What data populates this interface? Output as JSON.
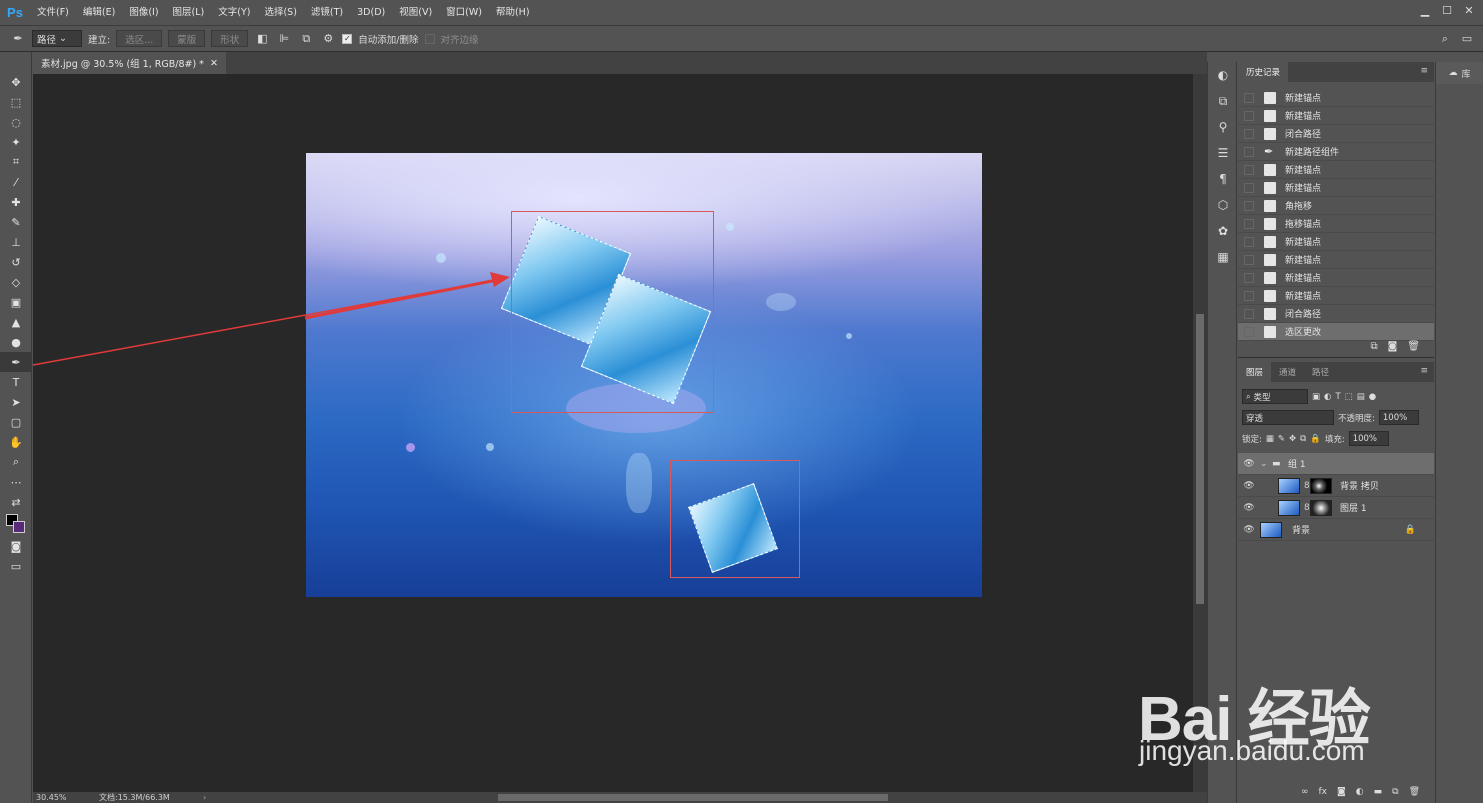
{
  "app": {
    "logo": "Ps"
  },
  "menu": [
    "文件(F)",
    "编辑(E)",
    "图像(I)",
    "图层(L)",
    "文字(Y)",
    "选择(S)",
    "滤镜(T)",
    "3D(D)",
    "视图(V)",
    "窗口(W)",
    "帮助(H)"
  ],
  "options": {
    "mode": "路径",
    "build_label": "建立:",
    "selection_btn": "选区...",
    "mask_btn": "蒙版",
    "shape_btn": "形状",
    "auto_add_delete": "自动添加/删除",
    "align_edges": "对齐边缘"
  },
  "document": {
    "tab_title": "素材.jpg @ 30.5% (组 1, RGB/8#) *",
    "zoom": "30.45%",
    "doc_size": "文档:15.3M/66.3M"
  },
  "history": {
    "title": "历史记录",
    "items": [
      "新建锚点",
      "新建锚点",
      "闭合路径",
      "新建路径组件",
      "新建锚点",
      "新建锚点",
      "角拖移",
      "拖移锚点",
      "新建锚点",
      "新建锚点",
      "新建锚点",
      "新建锚点",
      "闭合路径",
      "选区更改"
    ]
  },
  "layers": {
    "tabs": [
      "图层",
      "通道",
      "路径"
    ],
    "filter_label": "类型",
    "blend_mode": "穿透",
    "opacity_label": "不透明度:",
    "opacity": "100%",
    "lock_label": "锁定:",
    "fill_label": "填充:",
    "fill": "100%",
    "items": [
      {
        "name": "组 1"
      },
      {
        "name": "背景 拷贝"
      },
      {
        "name": "图层 1"
      },
      {
        "name": "背景"
      }
    ]
  },
  "library": {
    "label": "库"
  },
  "watermark": {
    "logo": "Bai 经验",
    "url": "jingyan.baidu.com"
  }
}
